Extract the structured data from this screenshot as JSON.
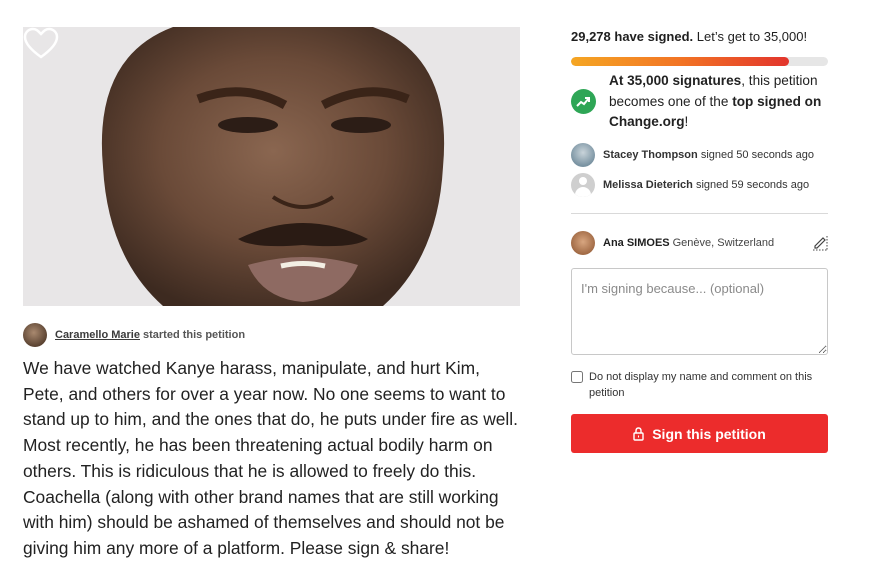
{
  "hero": {
    "image_description_icon": "heart-icon",
    "favorite_icon": "heart-icon"
  },
  "starter": {
    "name": "Caramello Marie",
    "verb": "started this petition"
  },
  "description": "We have watched Kanye harass, manipulate, and hurt Kim, Pete, and others for over a year now. No one seems to want to stand up to him, and the ones that do, he puts under fire as well. Most recently, he has been threatening actual bodily harm on others. This is ridiculous that he is allowed to freely do this. Coachella (along with other brand names that are still working with him) should be ashamed of themselves and should not be giving him any more of a platform. Please sign & share!",
  "progress": {
    "signed_count": "29,278 have signed.",
    "goal_text": "Let’s get to 35,000!",
    "fraction": 0.85
  },
  "milestone": {
    "bold1": "At 35,000 signatures",
    "text1": ", this petition becomes one of the ",
    "bold2": "top signed on Change.org",
    "text2": "!",
    "icon": "trending-up-icon"
  },
  "recent_signers": [
    {
      "name": "Stacey Thompson",
      "time": "signed 50 seconds ago"
    },
    {
      "name": "Melissa Dieterich",
      "time": "signed 59 seconds ago"
    }
  ],
  "current_user": {
    "name": "Ana SIMOES",
    "location": "Genève, Switzerland",
    "edit_icon": "edit-icon"
  },
  "comment": {
    "placeholder": "I'm signing because... (optional)",
    "value": ""
  },
  "privacy_checkbox": {
    "label": "Do not display my name and comment on this petition",
    "checked": false
  },
  "sign_button": {
    "label": "Sign this petition",
    "icon": "lock-icon"
  },
  "colors": {
    "accent_red": "#ec2c2c",
    "trend_green": "#2ea656",
    "bar_start": "#f5a623",
    "bar_end": "#e2342c"
  }
}
